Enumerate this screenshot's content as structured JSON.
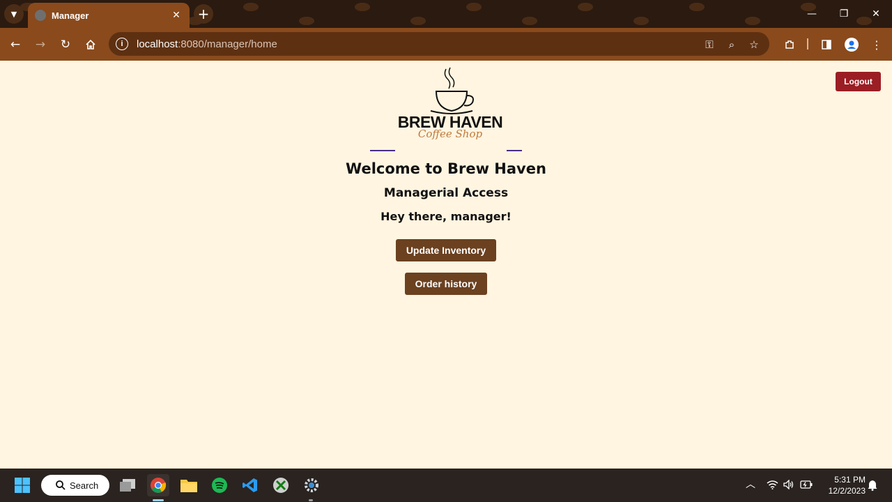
{
  "browser": {
    "tab_title": "Manager",
    "url_host": "localhost",
    "url_rest": ":8080/manager/home",
    "new_tab_label": "+",
    "tab_close": "✕"
  },
  "page": {
    "logout_label": "Logout",
    "logo_name": "BREW HAVEN",
    "logo_tagline": "Coffee Shop",
    "welcome": "Welcome to Brew Haven",
    "access": "Managerial Access",
    "greeting": "Hey there, manager!",
    "buttons": {
      "update_inventory": "Update Inventory",
      "order_history": "Order history"
    }
  },
  "taskbar": {
    "search_label": "Search",
    "time": "5:31 PM",
    "date": "12/2/2023"
  },
  "colors": {
    "page_bg": "#fff5e1",
    "button_brown": "#6b4120",
    "logout_red": "#9b1e24",
    "browser_brown": "#8a4a1c"
  },
  "icons": [
    "tab-menu-icon",
    "favicon-icon",
    "close-icon",
    "plus-icon",
    "minimize-icon",
    "restore-icon",
    "window-close-icon",
    "back-icon",
    "forward-icon",
    "reload-icon",
    "home-icon",
    "site-info-icon",
    "password-key-icon",
    "zoom-icon",
    "bookmark-star-icon",
    "extensions-icon",
    "side-panel-icon",
    "profile-icon",
    "menu-dots-icon",
    "coffee-cup-icon",
    "windows-start-icon",
    "search-icon",
    "task-view-icon",
    "chrome-icon",
    "file-explorer-icon",
    "spotify-icon",
    "vscode-icon",
    "xbox-icon",
    "settings-icon",
    "chevron-up-icon",
    "wifi-icon",
    "volume-icon",
    "battery-icon",
    "notification-bell-icon"
  ]
}
